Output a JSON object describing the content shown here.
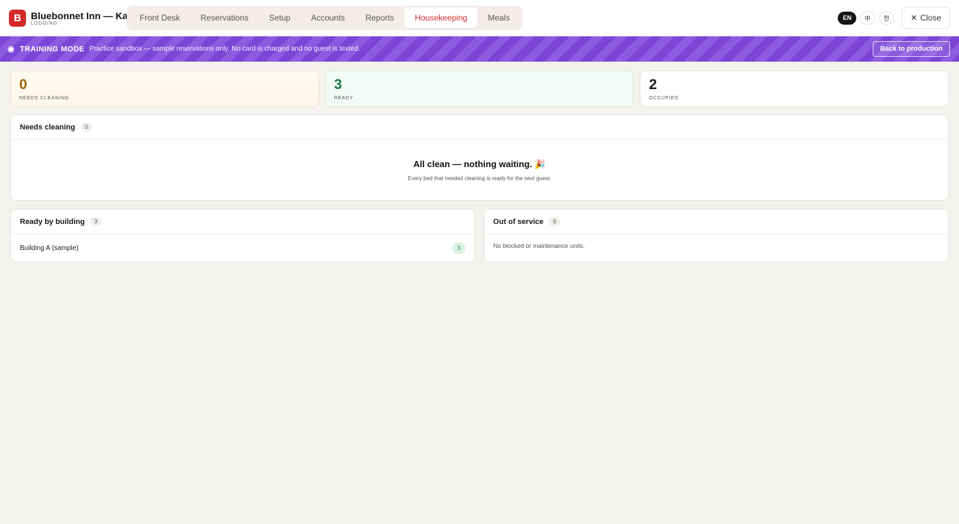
{
  "brand": {
    "logo_letter": "B",
    "name": "Bluebonnet Inn — Katy",
    "subtitle": "LODGING",
    "accent_color": "#d42a2a"
  },
  "nav": {
    "tabs": [
      {
        "label": "Front Desk",
        "active": false
      },
      {
        "label": "Reservations",
        "active": false
      },
      {
        "label": "Setup",
        "active": false
      },
      {
        "label": "Accounts",
        "active": false
      },
      {
        "label": "Reports",
        "active": false
      },
      {
        "label": "Housekeeping",
        "active": true
      },
      {
        "label": "Meals",
        "active": false
      }
    ]
  },
  "languages": [
    {
      "label": "EN",
      "active": true
    },
    {
      "label": "中",
      "active": false
    },
    {
      "label": "한",
      "active": false
    }
  ],
  "close": {
    "icon": "close-icon",
    "label": "Close"
  },
  "training": {
    "title": "TRAINING MODE",
    "message": "Practice sandbox — sample reservations only. No card is charged and no guest is texted.",
    "button": "Back to production",
    "color": "#7b45d6"
  },
  "stats": [
    {
      "value": "0",
      "label": "NEEDS CLEANING",
      "tone": "warn"
    },
    {
      "value": "3",
      "label": "READY",
      "tone": "good"
    },
    {
      "value": "2",
      "label": "OCCUPIED",
      "tone": "neutral"
    }
  ],
  "needs_cleaning": {
    "title": "Needs cleaning",
    "count": "0",
    "empty_title": "All clean — nothing waiting. 🎉",
    "empty_subtitle": "Every bed that needed cleaning is ready for the next guest."
  },
  "ready_by_building": {
    "title": "Ready by building",
    "count": "3",
    "buildings": [
      {
        "name": "Building A (sample)",
        "count": "3"
      }
    ]
  },
  "out_of_service": {
    "title": "Out of service",
    "count": "0",
    "empty_text": "No blocked or maintenance units."
  }
}
